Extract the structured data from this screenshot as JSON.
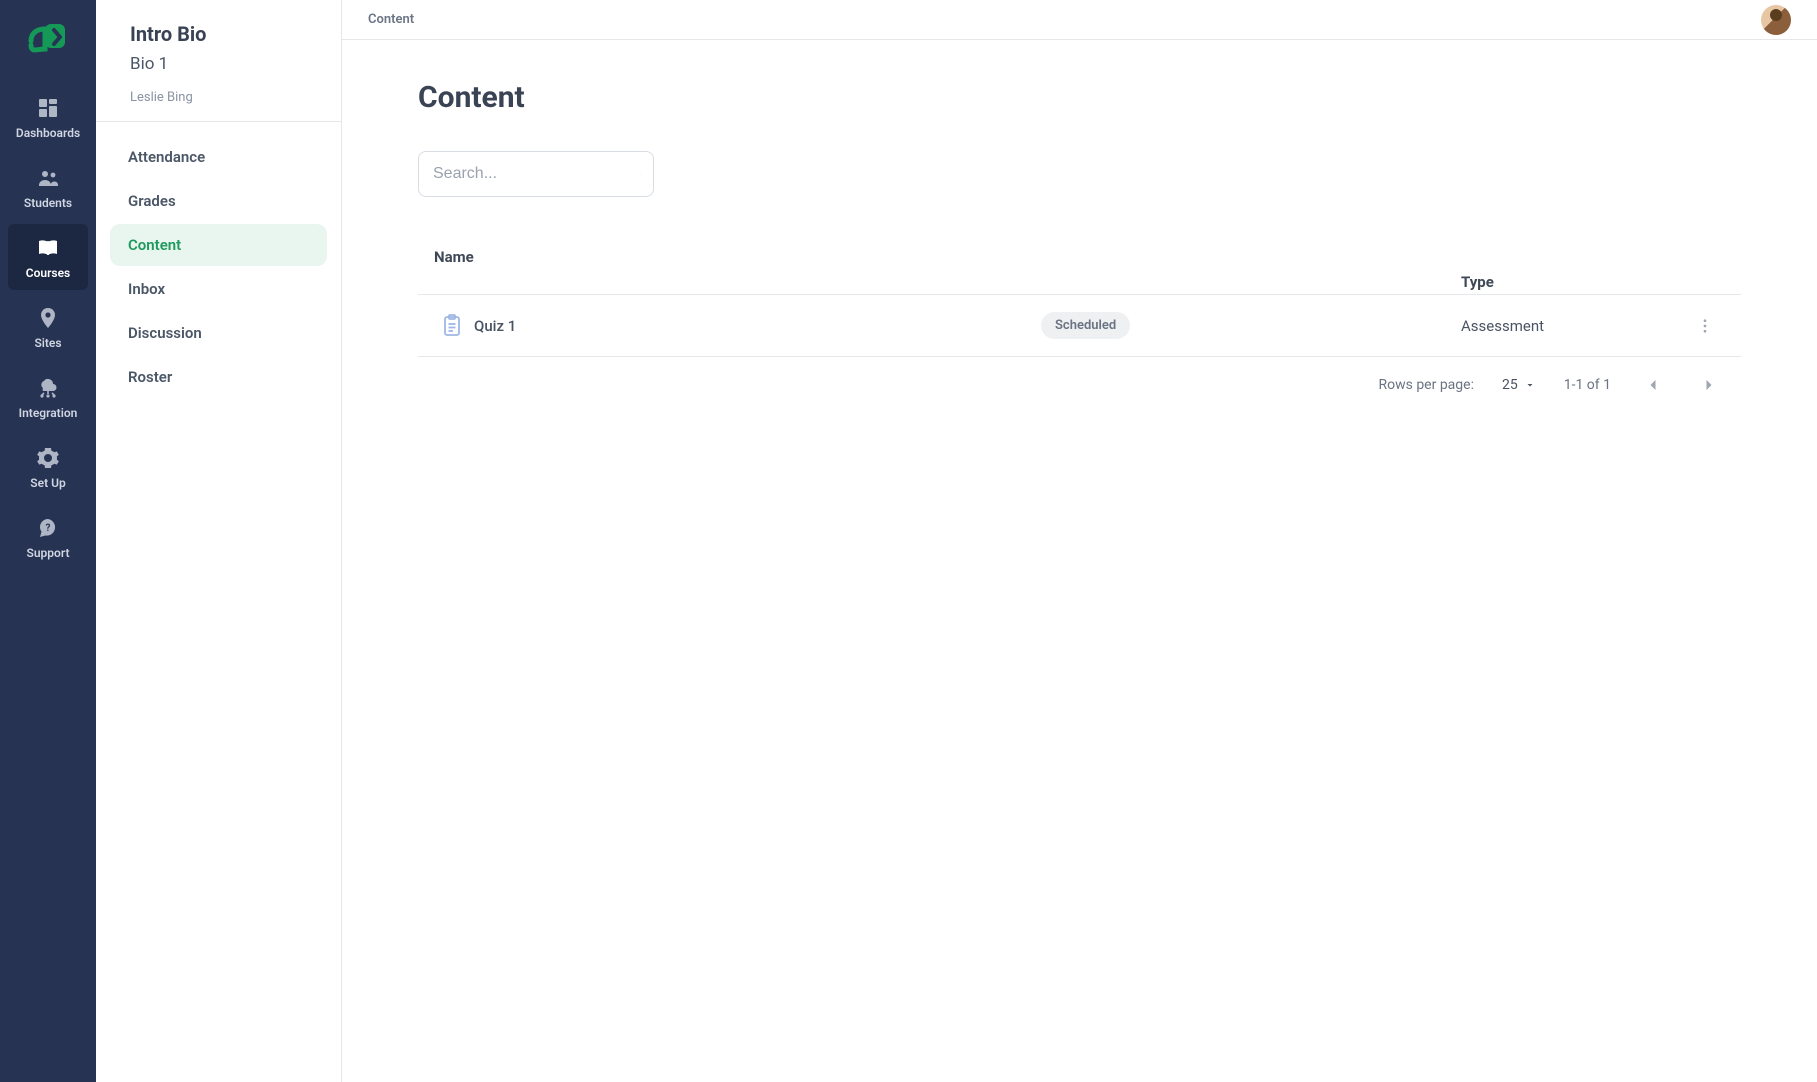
{
  "nav": {
    "items": [
      {
        "label": "Dashboards"
      },
      {
        "label": "Students"
      },
      {
        "label": "Courses"
      },
      {
        "label": "Sites"
      },
      {
        "label": "Integration"
      },
      {
        "label": "Set Up"
      },
      {
        "label": "Support"
      }
    ]
  },
  "subnav": {
    "course_title": "Intro Bio",
    "course_subtitle": "Bio 1",
    "instructor": "Leslie Bing",
    "items": [
      {
        "label": "Attendance"
      },
      {
        "label": "Grades"
      },
      {
        "label": "Content"
      },
      {
        "label": "Inbox"
      },
      {
        "label": "Discussion"
      },
      {
        "label": "Roster"
      }
    ]
  },
  "topbar": {
    "breadcrumb": "Content"
  },
  "page": {
    "title": "Content",
    "search_placeholder": "Search..."
  },
  "table": {
    "columns": {
      "name": "Name",
      "type": "Type"
    },
    "rows": [
      {
        "name": "Quiz 1",
        "status": "Scheduled",
        "type": "Assessment"
      }
    ]
  },
  "pagination": {
    "rows_per_page_label": "Rows per page:",
    "rows_per_page_value": "25",
    "range_text": "1-1 of 1"
  }
}
